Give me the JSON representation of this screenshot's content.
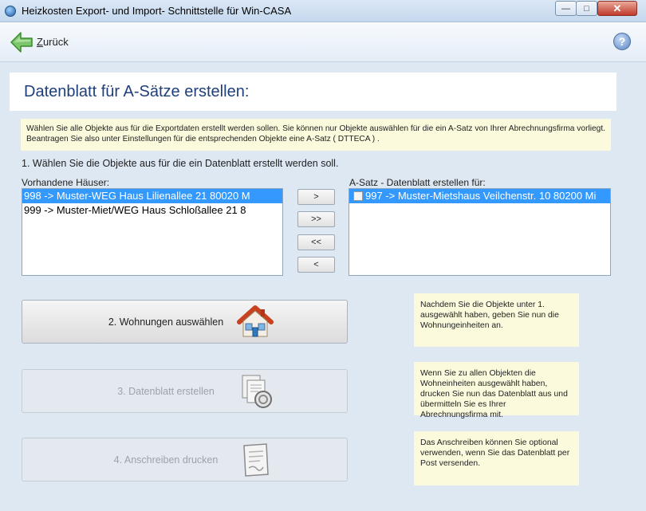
{
  "window": {
    "title": "Heizkosten Export- und Import- Schnittstelle für Win-CASA",
    "min_glyph": "—",
    "max_glyph": "□",
    "close_glyph": "✕"
  },
  "toolbar": {
    "back_first": "Z",
    "back_rest": "urück",
    "help_glyph": "?"
  },
  "heading": "Datenblatt für A-Sätze erstellen:",
  "info_note": "Wählen Sie alle Objekte aus für die Exportdaten erstellt werden sollen. Sie können nur Objekte auswählen für die ein A-Satz von Ihrer Abrechnungsfirma vorliegt. Beantragen Sie also unter Einstellungen für die entsprechenden Objekte eine A-Satz ( DTTECA ) .",
  "step1_label": "1. Wählen Sie die Objekte aus für die ein Datenblatt erstellt werden soll.",
  "left_list": {
    "label": "Vorhandene Häuser:",
    "items": [
      "998 -> Muster-WEG Haus  Lilienallee 21   80020 M",
      "999 -> Muster-Miet/WEG Haus  Schloßallee 21   8"
    ]
  },
  "right_list": {
    "label": "A-Satz - Datenblatt erstellen für:",
    "items": [
      "997 -> Muster-Mietshaus  Veilchenstr. 10   80200 Mi"
    ]
  },
  "transfer_buttons": {
    "add": ">",
    "add_all": ">>",
    "remove_all": "<<",
    "remove": "<"
  },
  "steps": [
    {
      "label": "2. Wohnungen auswählen",
      "icon": "house-icon",
      "enabled": true
    },
    {
      "label": "3. Datenblatt erstellen",
      "icon": "documents-icon",
      "enabled": false
    },
    {
      "label": "4. Anschreiben drucken",
      "icon": "letter-icon",
      "enabled": false
    }
  ],
  "notes": [
    "Nachdem Sie die Objekte unter 1. ausgewählt haben, geben Sie nun die Wohnungeinheiten an.",
    "Wenn Sie zu allen Objekten die Wohneinheiten ausgewählt haben, drucken Sie nun das Datenblatt aus und übermitteln Sie es Ihrer Abrechnungsfirma mit.",
    "Das Anschreiben können Sie optional verwenden, wenn Sie das Datenblatt per Post versenden."
  ],
  "colors": {
    "selection": "#3399ff",
    "heading": "#1f3f7a",
    "note_bg": "#fbfadd"
  }
}
